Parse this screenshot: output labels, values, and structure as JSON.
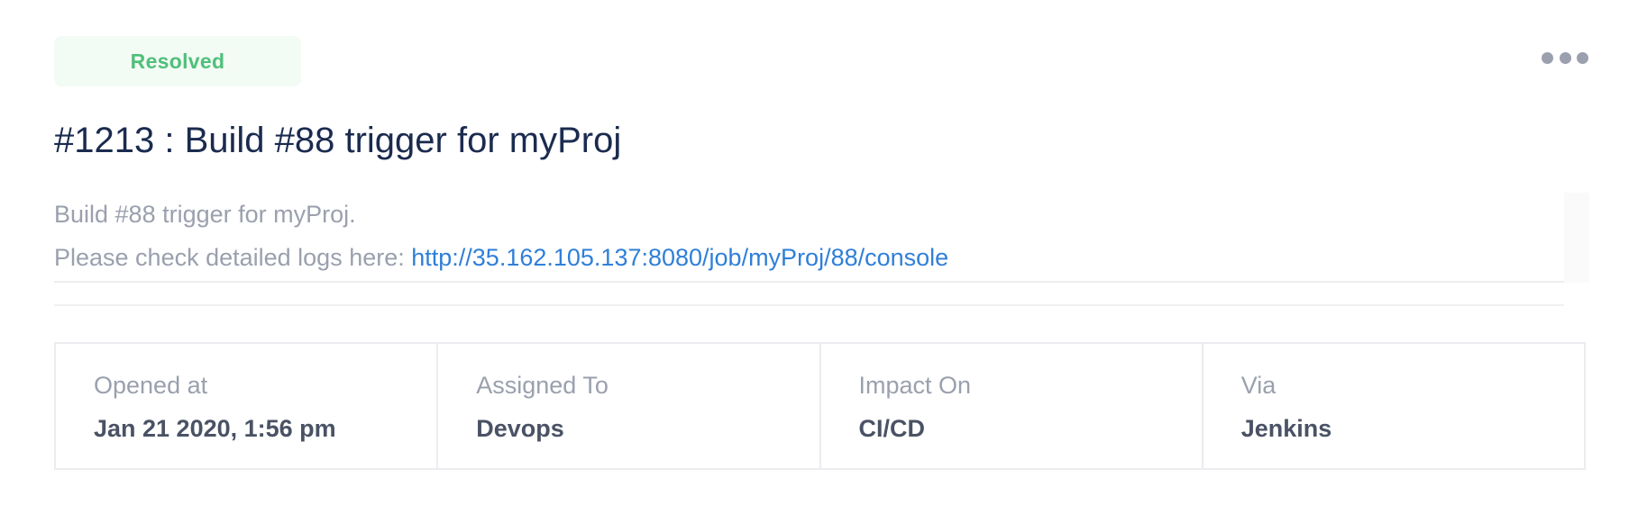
{
  "status": {
    "label": "Resolved",
    "color": "#4fc07a",
    "background": "#f3fbf5"
  },
  "actions": {
    "more_icon": "more-horizontal-icon"
  },
  "incident": {
    "title": "#1213 : Build #88 trigger for myProj",
    "description": {
      "line1": "Build #88 trigger for myProj.",
      "line2_prefix": "Please check detailed logs here: ",
      "link_text": "http://35.162.105.137:8080/job/myProj/88/console"
    }
  },
  "details": [
    {
      "label": "Opened at",
      "value": "Jan 21 2020, 1:56 pm"
    },
    {
      "label": "Assigned To",
      "value": "Devops"
    },
    {
      "label": "Impact On",
      "value": "CI/CD"
    },
    {
      "label": "Via",
      "value": "Jenkins"
    }
  ],
  "colors": {
    "title": "#1b2b4f",
    "muted_text": "#9aa0ad",
    "link": "#2f7fd8",
    "value_text": "#4a5265",
    "border": "#eaecef"
  }
}
